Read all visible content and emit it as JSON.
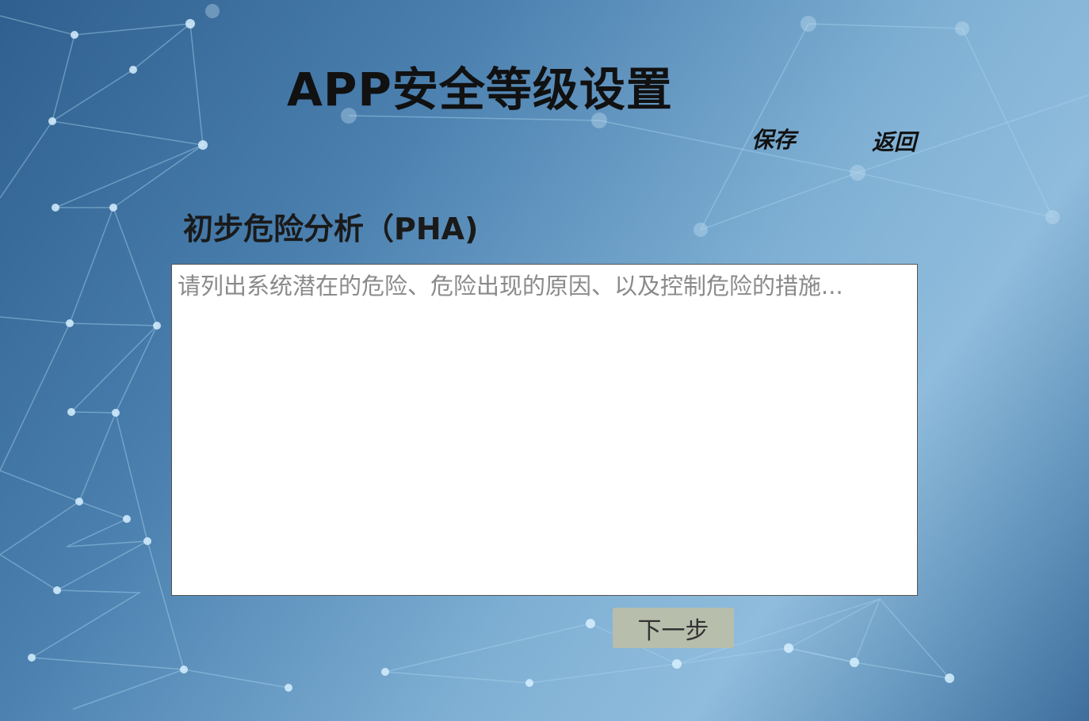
{
  "header": {
    "title": "APP安全等级设置",
    "save_label": "保存",
    "back_label": "返回"
  },
  "section": {
    "title": "初步危险分析（PHA)"
  },
  "pha_input": {
    "value": "",
    "placeholder": "请列出系统潜在的危险、危险出现的原因、以及控制危险的措施..."
  },
  "footer": {
    "next_label": "下一步"
  }
}
